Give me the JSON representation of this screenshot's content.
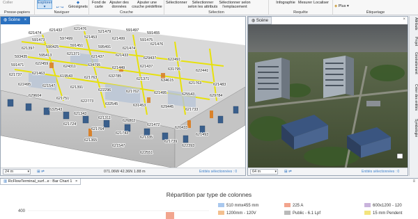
{
  "ribbon": {
    "groups": [
      {
        "label": "Presse-papiers",
        "buttons": [
          "Coller"
        ]
      },
      {
        "label": "Naviguer",
        "buttons": [
          "Explorer",
          "Géosignets"
        ]
      },
      {
        "label": "Couche",
        "buttons": [
          "Fond de carte",
          "Ajouter des données",
          "Ajouter une couche prédéfinie"
        ]
      },
      {
        "label": "Sélection",
        "buttons": [
          "Sélectionner",
          "Sélectionner selon les attributs",
          "Sélectionner selon l'emplacement"
        ]
      },
      {
        "label": "Requête",
        "buttons": [
          "Infographie",
          "Mesurer",
          "Localiser"
        ]
      },
      {
        "label": "Étiquetage",
        "buttons": [
          "Plus"
        ]
      }
    ]
  },
  "left_view": {
    "tab": "Scène",
    "scale": "24 m",
    "coords": "071.06W 42.36N  1.88 m",
    "selected": "Entités sélectionnées : 0",
    "labels": [
      "621474",
      "621432",
      "621476",
      "521479",
      "591497",
      "591455",
      "591473",
      "597499",
      "521453",
      "621499",
      "591475",
      "621397",
      "590425",
      "591451",
      "595491",
      "621474",
      "621476",
      "593435",
      "595413",
      "621371",
      "621437",
      "621433",
      "629437",
      "622491",
      "591471",
      "622459",
      "624311",
      "634795",
      "621449",
      "621437",
      "631795",
      "622441",
      "621737",
      "621463",
      "619543",
      "621763",
      "632785",
      "621371",
      "634615",
      "621763",
      "621483",
      "622495",
      "621547",
      "621391",
      "622296",
      "621762",
      "621495",
      "625543",
      "629784",
      "629604",
      "621751",
      "622773",
      "632545",
      "631453",
      "629445",
      "621733",
      "632543",
      "621343",
      "621311",
      "626802",
      "621472",
      "620433",
      "621724",
      "621764",
      "621743",
      "621335",
      "621739",
      "621493",
      "621365",
      "621547",
      "622551",
      "622393"
    ]
  },
  "right_view": {
    "tab": "Scène",
    "scale": "64 m",
    "selected": "Entités sélectionnées : 0"
  },
  "vertical_tabs": [
    "Attributs",
    "Projet",
    "Géotraitement",
    "Créer des entités",
    "Symbologie"
  ],
  "chart_pane": {
    "tab": "RcFlowTerminal_surf...e : Bar Chart 1",
    "title": "Répartition par type de colonnes"
  },
  "chart_data": {
    "type": "bar",
    "title": "Répartition par type de colonnes",
    "yticks": [
      400
    ],
    "categories": [
      "510 mmx455 mm",
      "225 A",
      "600x1200 - 120",
      "1200mm - 120V",
      "Public - 6.1 Lpf",
      "15 mm Pendent"
    ],
    "colors": {
      "510 mmx455 mm": "#a9c8ee",
      "225 A": "#f2a58e",
      "600x1200 - 120": "#c9b3dc",
      "1200mm - 120V": "#f3c08f",
      "Public - 6.1 Lpf": "#b9b9b9",
      "15 mm Pendent": "#f3e47e"
    }
  }
}
